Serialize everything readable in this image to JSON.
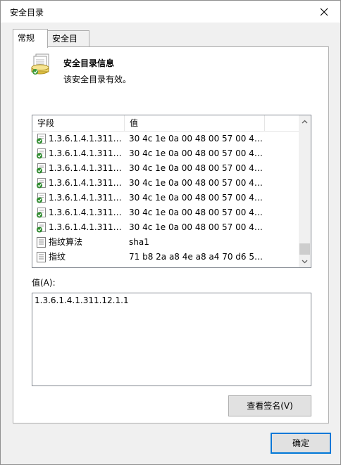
{
  "window": {
    "title": "安全目录"
  },
  "tabs": [
    {
      "label": "常规",
      "active": true
    },
    {
      "label": "安全目录",
      "active": false
    }
  ],
  "info": {
    "title": "安全目录信息",
    "status": "该安全目录有效。"
  },
  "list": {
    "columns": {
      "field": "字段",
      "value": "值"
    },
    "rows": [
      {
        "icon": "attribute-icon",
        "field": "1.3.6.1.4.1.311.1...",
        "value": "30 4c 1e 0a 00 48 00 57 00 49 ..."
      },
      {
        "icon": "attribute-icon",
        "field": "1.3.6.1.4.1.311.1...",
        "value": "30 4c 1e 0a 00 48 00 57 00 49 ..."
      },
      {
        "icon": "attribute-icon",
        "field": "1.3.6.1.4.1.311.1...",
        "value": "30 4c 1e 0a 00 48 00 57 00 49 ..."
      },
      {
        "icon": "attribute-icon",
        "field": "1.3.6.1.4.1.311.1...",
        "value": "30 4c 1e 0a 00 48 00 57 00 49 ..."
      },
      {
        "icon": "attribute-icon",
        "field": "1.3.6.1.4.1.311.1...",
        "value": "30 4c 1e 0a 00 48 00 57 00 49 ..."
      },
      {
        "icon": "attribute-icon",
        "field": "1.3.6.1.4.1.311.1...",
        "value": "30 4c 1e 0a 00 48 00 57 00 49 ..."
      },
      {
        "icon": "attribute-icon",
        "field": "1.3.6.1.4.1.311.1...",
        "value": "30 4c 1e 0a 00 48 00 57 00 49 ..."
      },
      {
        "icon": "property-icon",
        "field": "指纹算法",
        "value": "sha1"
      },
      {
        "icon": "property-icon",
        "field": "指纹",
        "value": "71 b8 2a a8 4e a8 a4 70 d6 5a..."
      }
    ]
  },
  "detail": {
    "label": "值(A):",
    "value": "1.3.6.1.4.1.311.12.1.1"
  },
  "buttons": {
    "view_signature": "查看签名(V)",
    "ok": "确定"
  },
  "icons": {
    "close": "close-icon",
    "catalog": "security-catalog-icon",
    "scroll_up": "chevron-up-icon",
    "scroll_down": "chevron-down-icon"
  }
}
